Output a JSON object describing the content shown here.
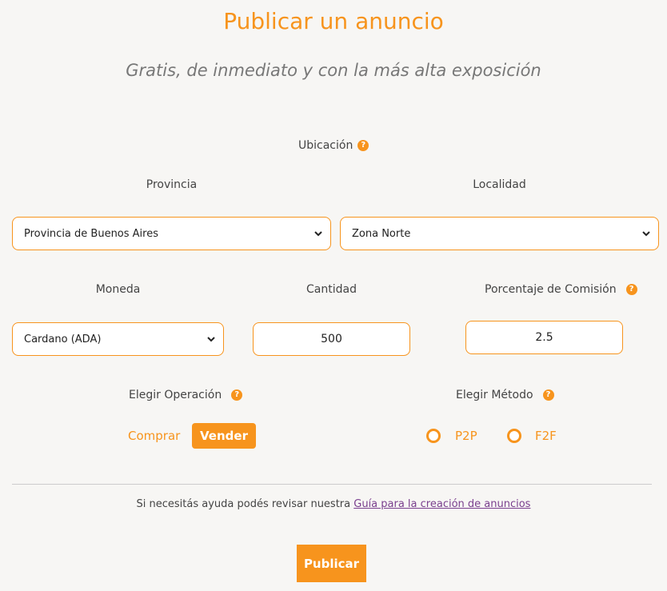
{
  "header": {
    "title": "Publicar un anuncio",
    "subtitle": "Gratis, de inmediato y con la más alta exposición"
  },
  "location": {
    "label": "Ubicación",
    "province_label": "Provincia",
    "province_value": "Provincia de Buenos Aires",
    "locality_label": "Localidad",
    "locality_value": "Zona Norte"
  },
  "trade": {
    "currency_label": "Moneda",
    "currency_value": "Cardano (ADA)",
    "amount_label": "Cantidad",
    "amount_value": "500",
    "commission_label": "Porcentaje de Comisión",
    "commission_value": "2.5"
  },
  "operation": {
    "label": "Elegir Operación",
    "buy_label": "Comprar",
    "sell_label": "Vender",
    "selected": "Vender"
  },
  "method": {
    "label": "Elegir Método",
    "options": [
      "P2P",
      "F2F"
    ]
  },
  "help": {
    "text": "Si necesitás ayuda podés revisar nuestra ",
    "link_text": "Guía para la creación de anuncios"
  },
  "publish_label": "Publicar",
  "colors": {
    "accent": "#f7941d",
    "link": "#7a3f8e",
    "background": "#f7f6f4"
  }
}
